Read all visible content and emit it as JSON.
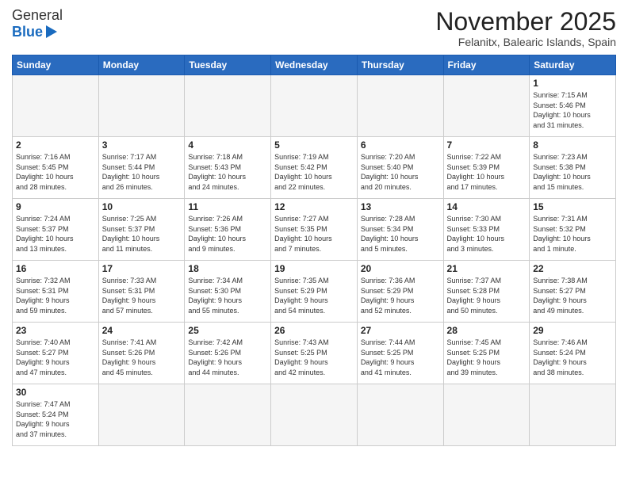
{
  "header": {
    "logo_general": "General",
    "logo_blue": "Blue",
    "month_title": "November 2025",
    "location": "Felanitx, Balearic Islands, Spain"
  },
  "days_of_week": [
    "Sunday",
    "Monday",
    "Tuesday",
    "Wednesday",
    "Thursday",
    "Friday",
    "Saturday"
  ],
  "weeks": [
    [
      {
        "day": "",
        "info": ""
      },
      {
        "day": "",
        "info": ""
      },
      {
        "day": "",
        "info": ""
      },
      {
        "day": "",
        "info": ""
      },
      {
        "day": "",
        "info": ""
      },
      {
        "day": "",
        "info": ""
      },
      {
        "day": "1",
        "info": "Sunrise: 7:15 AM\nSunset: 5:46 PM\nDaylight: 10 hours\nand 31 minutes."
      }
    ],
    [
      {
        "day": "2",
        "info": "Sunrise: 7:16 AM\nSunset: 5:45 PM\nDaylight: 10 hours\nand 28 minutes."
      },
      {
        "day": "3",
        "info": "Sunrise: 7:17 AM\nSunset: 5:44 PM\nDaylight: 10 hours\nand 26 minutes."
      },
      {
        "day": "4",
        "info": "Sunrise: 7:18 AM\nSunset: 5:43 PM\nDaylight: 10 hours\nand 24 minutes."
      },
      {
        "day": "5",
        "info": "Sunrise: 7:19 AM\nSunset: 5:42 PM\nDaylight: 10 hours\nand 22 minutes."
      },
      {
        "day": "6",
        "info": "Sunrise: 7:20 AM\nSunset: 5:40 PM\nDaylight: 10 hours\nand 20 minutes."
      },
      {
        "day": "7",
        "info": "Sunrise: 7:22 AM\nSunset: 5:39 PM\nDaylight: 10 hours\nand 17 minutes."
      },
      {
        "day": "8",
        "info": "Sunrise: 7:23 AM\nSunset: 5:38 PM\nDaylight: 10 hours\nand 15 minutes."
      }
    ],
    [
      {
        "day": "9",
        "info": "Sunrise: 7:24 AM\nSunset: 5:37 PM\nDaylight: 10 hours\nand 13 minutes."
      },
      {
        "day": "10",
        "info": "Sunrise: 7:25 AM\nSunset: 5:37 PM\nDaylight: 10 hours\nand 11 minutes."
      },
      {
        "day": "11",
        "info": "Sunrise: 7:26 AM\nSunset: 5:36 PM\nDaylight: 10 hours\nand 9 minutes."
      },
      {
        "day": "12",
        "info": "Sunrise: 7:27 AM\nSunset: 5:35 PM\nDaylight: 10 hours\nand 7 minutes."
      },
      {
        "day": "13",
        "info": "Sunrise: 7:28 AM\nSunset: 5:34 PM\nDaylight: 10 hours\nand 5 minutes."
      },
      {
        "day": "14",
        "info": "Sunrise: 7:30 AM\nSunset: 5:33 PM\nDaylight: 10 hours\nand 3 minutes."
      },
      {
        "day": "15",
        "info": "Sunrise: 7:31 AM\nSunset: 5:32 PM\nDaylight: 10 hours\nand 1 minute."
      }
    ],
    [
      {
        "day": "16",
        "info": "Sunrise: 7:32 AM\nSunset: 5:31 PM\nDaylight: 9 hours\nand 59 minutes."
      },
      {
        "day": "17",
        "info": "Sunrise: 7:33 AM\nSunset: 5:31 PM\nDaylight: 9 hours\nand 57 minutes."
      },
      {
        "day": "18",
        "info": "Sunrise: 7:34 AM\nSunset: 5:30 PM\nDaylight: 9 hours\nand 55 minutes."
      },
      {
        "day": "19",
        "info": "Sunrise: 7:35 AM\nSunset: 5:29 PM\nDaylight: 9 hours\nand 54 minutes."
      },
      {
        "day": "20",
        "info": "Sunrise: 7:36 AM\nSunset: 5:29 PM\nDaylight: 9 hours\nand 52 minutes."
      },
      {
        "day": "21",
        "info": "Sunrise: 7:37 AM\nSunset: 5:28 PM\nDaylight: 9 hours\nand 50 minutes."
      },
      {
        "day": "22",
        "info": "Sunrise: 7:38 AM\nSunset: 5:27 PM\nDaylight: 9 hours\nand 49 minutes."
      }
    ],
    [
      {
        "day": "23",
        "info": "Sunrise: 7:40 AM\nSunset: 5:27 PM\nDaylight: 9 hours\nand 47 minutes."
      },
      {
        "day": "24",
        "info": "Sunrise: 7:41 AM\nSunset: 5:26 PM\nDaylight: 9 hours\nand 45 minutes."
      },
      {
        "day": "25",
        "info": "Sunrise: 7:42 AM\nSunset: 5:26 PM\nDaylight: 9 hours\nand 44 minutes."
      },
      {
        "day": "26",
        "info": "Sunrise: 7:43 AM\nSunset: 5:25 PM\nDaylight: 9 hours\nand 42 minutes."
      },
      {
        "day": "27",
        "info": "Sunrise: 7:44 AM\nSunset: 5:25 PM\nDaylight: 9 hours\nand 41 minutes."
      },
      {
        "day": "28",
        "info": "Sunrise: 7:45 AM\nSunset: 5:25 PM\nDaylight: 9 hours\nand 39 minutes."
      },
      {
        "day": "29",
        "info": "Sunrise: 7:46 AM\nSunset: 5:24 PM\nDaylight: 9 hours\nand 38 minutes."
      }
    ],
    [
      {
        "day": "30",
        "info": "Sunrise: 7:47 AM\nSunset: 5:24 PM\nDaylight: 9 hours\nand 37 minutes."
      },
      {
        "day": "",
        "info": ""
      },
      {
        "day": "",
        "info": ""
      },
      {
        "day": "",
        "info": ""
      },
      {
        "day": "",
        "info": ""
      },
      {
        "day": "",
        "info": ""
      },
      {
        "day": "",
        "info": ""
      }
    ]
  ]
}
